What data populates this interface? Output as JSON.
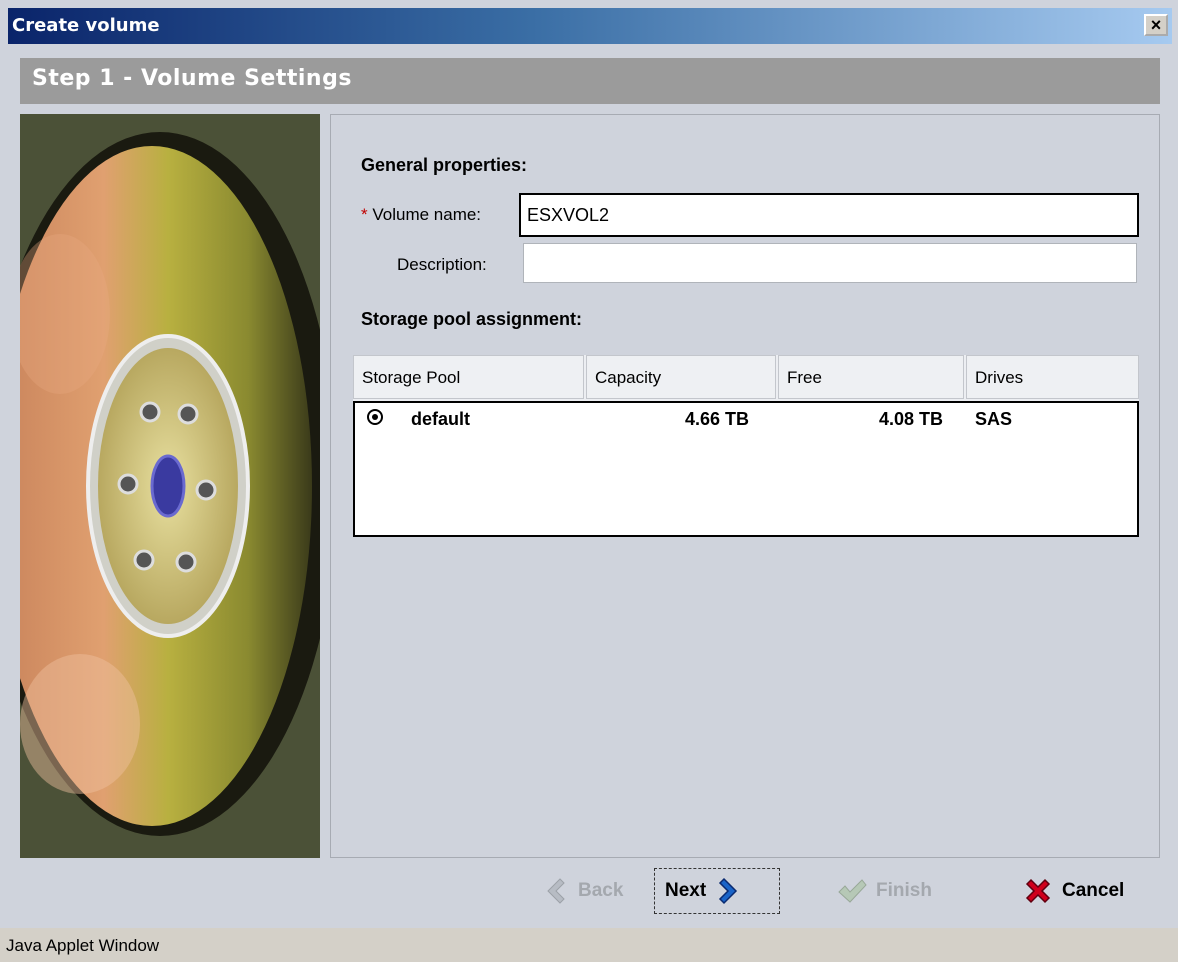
{
  "window": {
    "title": "Create volume",
    "close_label": "×"
  },
  "step": {
    "title": "Step 1 - Volume Settings"
  },
  "form": {
    "general_heading": "General properties:",
    "required_marker": "*",
    "volume_name_label": "Volume name:",
    "volume_name_value": "ESXVOL2",
    "description_label": "Description:",
    "description_value": "",
    "pool_heading": "Storage pool assignment:"
  },
  "table": {
    "columns": [
      "Storage Pool",
      "Capacity",
      "Free",
      "Drives"
    ],
    "rows": [
      {
        "pool": "default",
        "capacity": "4.66 TB",
        "free": "4.08 TB",
        "drives": "SAS",
        "selected": true
      }
    ]
  },
  "buttons": {
    "back": "Back",
    "next": "Next",
    "finish": "Finish",
    "cancel": "Cancel"
  },
  "status": {
    "text": "Java Applet Window"
  },
  "colors": {
    "titlebar_start": "#0a246a",
    "titlebar_end": "#a6caf0",
    "panel_bg": "#cfd3dc",
    "step_bar": "#9b9b9b",
    "cancel_icon": "#d0001c",
    "next_icon": "#1a64c8",
    "disabled": "#a4a8ae"
  }
}
